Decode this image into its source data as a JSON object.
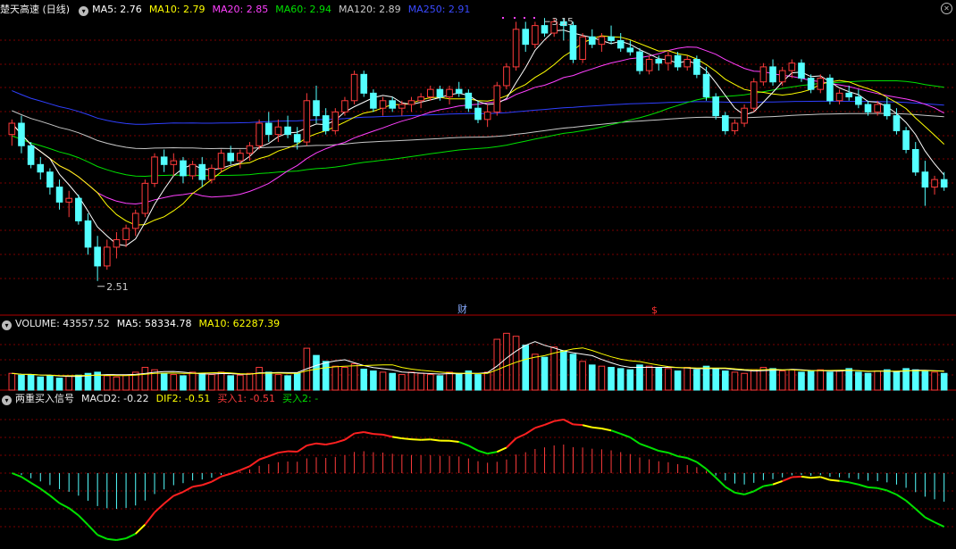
{
  "colors": {
    "up": "#ff3b3b",
    "down": "#54ffff",
    "ma5": "#ffffff",
    "ma10": "#ffff00",
    "ma20": "#ff40ff",
    "ma60": "#00e000",
    "ma120": "#c8c8c8",
    "ma250": "#2f3fff",
    "grid": "#7a0000",
    "divider": "#b00000"
  },
  "main": {
    "title": "楚天高速 (日线)",
    "ma5": "MA5: 2.76",
    "ma10": "MA10: 2.79",
    "ma20": "MA20: 2.85",
    "ma60": "MA60: 2.94",
    "ma120": "MA120: 2.89",
    "ma250": "MA250: 2.91",
    "high_label": "3.15",
    "low_label": "2.51",
    "event_marker_1": "财",
    "event_marker_2": "$"
  },
  "volume": {
    "title": "VOLUME: 43557.52",
    "ma5": "MA5: 58334.78",
    "ma10": "MA10: 62287.39"
  },
  "macd": {
    "title": "两重买入信号",
    "macd2": "MACD2: -0.22",
    "dif2": "DIF2: -0.51",
    "buy1": "买入1: -0.51",
    "buy2": "买入2: -"
  },
  "chart_data": {
    "type": "candlestick",
    "price_range_visible": [
      2.45,
      3.22
    ],
    "candles": [
      [
        2.9,
        2.94,
        2.87,
        2.93
      ],
      [
        2.93,
        2.95,
        2.85,
        2.87
      ],
      [
        2.87,
        2.88,
        2.81,
        2.82
      ],
      [
        2.82,
        2.84,
        2.78,
        2.8
      ],
      [
        2.8,
        2.81,
        2.74,
        2.76
      ],
      [
        2.76,
        2.78,
        2.7,
        2.72
      ],
      [
        2.72,
        2.75,
        2.68,
        2.73
      ],
      [
        2.73,
        2.74,
        2.66,
        2.67
      ],
      [
        2.67,
        2.69,
        2.58,
        2.6
      ],
      [
        2.6,
        2.63,
        2.51,
        2.55
      ],
      [
        2.55,
        2.62,
        2.54,
        2.6
      ],
      [
        2.6,
        2.64,
        2.57,
        2.62
      ],
      [
        2.62,
        2.66,
        2.6,
        2.65
      ],
      [
        2.65,
        2.7,
        2.63,
        2.69
      ],
      [
        2.69,
        2.78,
        2.68,
        2.77
      ],
      [
        2.77,
        2.85,
        2.76,
        2.84
      ],
      [
        2.84,
        2.86,
        2.8,
        2.82
      ],
      [
        2.82,
        2.85,
        2.79,
        2.83
      ],
      [
        2.83,
        2.84,
        2.77,
        2.79
      ],
      [
        2.79,
        2.83,
        2.78,
        2.82
      ],
      [
        2.82,
        2.84,
        2.76,
        2.78
      ],
      [
        2.78,
        2.82,
        2.77,
        2.81
      ],
      [
        2.81,
        2.86,
        2.8,
        2.85
      ],
      [
        2.85,
        2.87,
        2.82,
        2.83
      ],
      [
        2.83,
        2.86,
        2.81,
        2.85
      ],
      [
        2.85,
        2.88,
        2.83,
        2.87
      ],
      [
        2.87,
        2.94,
        2.86,
        2.93
      ],
      [
        2.93,
        2.96,
        2.88,
        2.9
      ],
      [
        2.9,
        2.94,
        2.88,
        2.92
      ],
      [
        2.92,
        2.95,
        2.89,
        2.9
      ],
      [
        2.9,
        2.92,
        2.86,
        2.88
      ],
      [
        2.88,
        3.01,
        2.87,
        2.99
      ],
      [
        2.99,
        3.03,
        2.93,
        2.95
      ],
      [
        2.95,
        2.97,
        2.9,
        2.91
      ],
      [
        2.91,
        2.97,
        2.9,
        2.96
      ],
      [
        2.96,
        3.0,
        2.95,
        2.99
      ],
      [
        2.99,
        3.07,
        2.98,
        3.06
      ],
      [
        3.06,
        3.07,
        3.0,
        3.01
      ],
      [
        3.01,
        3.02,
        2.96,
        2.97
      ],
      [
        2.97,
        3.0,
        2.95,
        2.99
      ],
      [
        2.99,
        3.0,
        2.96,
        2.97
      ],
      [
        2.97,
        2.99,
        2.95,
        2.98
      ],
      [
        2.98,
        3.0,
        2.96,
        2.99
      ],
      [
        2.99,
        3.01,
        2.97,
        3.0
      ],
      [
        3.0,
        3.03,
        2.99,
        3.02
      ],
      [
        3.02,
        3.03,
        2.99,
        3.0
      ],
      [
        3.0,
        3.03,
        2.98,
        3.02
      ],
      [
        3.02,
        3.04,
        3.0,
        3.01
      ],
      [
        3.01,
        3.02,
        2.96,
        2.97
      ],
      [
        2.97,
        2.99,
        2.93,
        2.94
      ],
      [
        2.94,
        2.98,
        2.92,
        2.96
      ],
      [
        2.96,
        3.04,
        2.95,
        3.03
      ],
      [
        3.03,
        3.09,
        3.02,
        3.08
      ],
      [
        3.08,
        3.2,
        3.07,
        3.18
      ],
      [
        3.18,
        3.2,
        3.12,
        3.14
      ],
      [
        3.14,
        3.2,
        3.13,
        3.19
      ],
      [
        3.19,
        3.21,
        3.16,
        3.17
      ],
      [
        3.17,
        3.21,
        3.16,
        3.2
      ],
      [
        3.2,
        3.21,
        3.15,
        3.19
      ],
      [
        3.19,
        3.2,
        3.09,
        3.1
      ],
      [
        3.1,
        3.17,
        3.09,
        3.16
      ],
      [
        3.16,
        3.18,
        3.13,
        3.14
      ],
      [
        3.14,
        3.17,
        3.12,
        3.16
      ],
      [
        3.16,
        3.19,
        3.14,
        3.15
      ],
      [
        3.15,
        3.17,
        3.12,
        3.13
      ],
      [
        3.13,
        3.15,
        3.11,
        3.12
      ],
      [
        3.12,
        3.13,
        3.06,
        3.07
      ],
      [
        3.07,
        3.11,
        3.06,
        3.1
      ],
      [
        3.1,
        3.11,
        3.07,
        3.09
      ],
      [
        3.09,
        3.12,
        3.07,
        3.11
      ],
      [
        3.11,
        3.12,
        3.07,
        3.08
      ],
      [
        3.08,
        3.11,
        3.07,
        3.1
      ],
      [
        3.1,
        3.11,
        3.05,
        3.06
      ],
      [
        3.06,
        3.08,
        2.99,
        3.0
      ],
      [
        3.0,
        3.01,
        2.94,
        2.95
      ],
      [
        2.95,
        2.96,
        2.9,
        2.91
      ],
      [
        2.91,
        2.94,
        2.9,
        2.93
      ],
      [
        2.93,
        2.98,
        2.92,
        2.97
      ],
      [
        2.97,
        3.05,
        2.96,
        3.04
      ],
      [
        3.04,
        3.09,
        3.03,
        3.08
      ],
      [
        3.08,
        3.1,
        3.03,
        3.04
      ],
      [
        3.04,
        3.08,
        3.03,
        3.07
      ],
      [
        3.07,
        3.1,
        3.05,
        3.09
      ],
      [
        3.09,
        3.1,
        3.04,
        3.05
      ],
      [
        3.05,
        3.06,
        3.01,
        3.02
      ],
      [
        3.02,
        3.06,
        3.01,
        3.05
      ],
      [
        3.05,
        3.06,
        2.98,
        2.99
      ],
      [
        2.99,
        3.02,
        2.98,
        3.01
      ],
      [
        3.01,
        3.03,
        2.99,
        3.0
      ],
      [
        3.0,
        3.02,
        2.97,
        2.98
      ],
      [
        2.98,
        2.99,
        2.95,
        2.96
      ],
      [
        2.96,
        2.99,
        2.95,
        2.98
      ],
      [
        2.98,
        3.0,
        2.94,
        2.95
      ],
      [
        2.95,
        2.97,
        2.9,
        2.91
      ],
      [
        2.91,
        2.92,
        2.85,
        2.86
      ],
      [
        2.86,
        2.88,
        2.79,
        2.8
      ],
      [
        2.8,
        2.83,
        2.71,
        2.76
      ],
      [
        2.76,
        2.79,
        2.74,
        2.78
      ],
      [
        2.78,
        2.8,
        2.75,
        2.76
      ]
    ],
    "volume": [
      28,
      25,
      26,
      22,
      24,
      20,
      23,
      25,
      28,
      30,
      24,
      22,
      25,
      30,
      38,
      34,
      28,
      26,
      24,
      30,
      28,
      26,
      30,
      24,
      25,
      28,
      38,
      30,
      26,
      24,
      28,
      70,
      58,
      48,
      40,
      38,
      44,
      35,
      32,
      30,
      28,
      26,
      30,
      28,
      26,
      24,
      30,
      28,
      32,
      26,
      30,
      85,
      95,
      90,
      75,
      60,
      55,
      72,
      66,
      60,
      48,
      42,
      40,
      38,
      36,
      34,
      42,
      40,
      38,
      36,
      32,
      38,
      34,
      40,
      36,
      32,
      30,
      28,
      34,
      38,
      36,
      32,
      34,
      30,
      32,
      34,
      30,
      32,
      36,
      30,
      28,
      32,
      34,
      30,
      36,
      34,
      32,
      30,
      28
    ],
    "legend": [
      "MA5",
      "MA10",
      "MA20",
      "MA60",
      "MA120",
      "MA250"
    ]
  }
}
